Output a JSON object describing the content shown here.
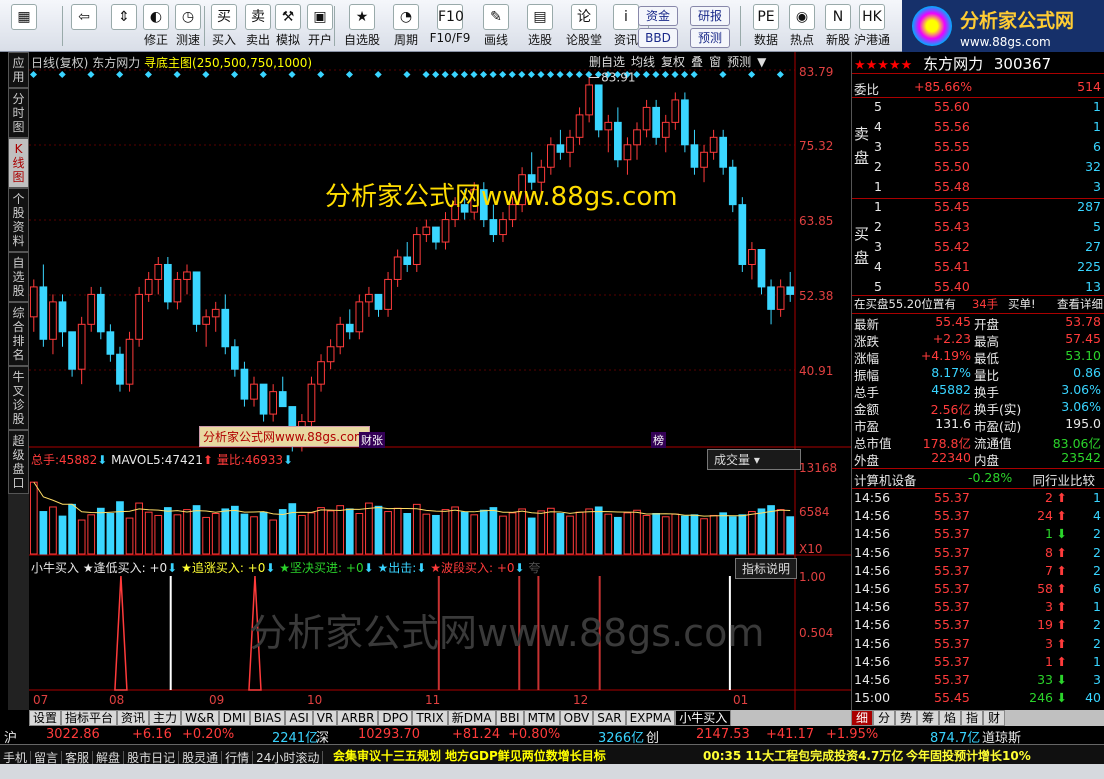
{
  "toolbar": {
    "buttons": [
      {
        "label": "",
        "icon": "windows-icon",
        "glyph": "▦"
      },
      {
        "label": "",
        "icon": "back-arrow-icon",
        "glyph": "⇦"
      },
      {
        "label": "",
        "icon": "updown-icon",
        "glyph": "⇕"
      },
      {
        "label": "修正",
        "icon": "repair-icon",
        "glyph": "◐"
      },
      {
        "label": "测速",
        "icon": "speed-icon",
        "glyph": "◷"
      },
      {
        "label": "买入",
        "icon": "buy-icon",
        "glyph": "买"
      },
      {
        "label": "卖出",
        "icon": "sell-icon",
        "glyph": "卖"
      },
      {
        "label": "模拟",
        "icon": "hammer-icon",
        "glyph": "⚒"
      },
      {
        "label": "开户",
        "icon": "lock-icon",
        "glyph": "▣"
      },
      {
        "label": "自选股",
        "icon": "star-folder-icon",
        "glyph": "★"
      },
      {
        "label": "周期",
        "icon": "clock-icon",
        "glyph": "◔"
      },
      {
        "label": "F10/F9",
        "icon": "f10-icon",
        "glyph": "F10"
      },
      {
        "label": "画线",
        "icon": "pen-icon",
        "glyph": "✎"
      },
      {
        "label": "选股",
        "icon": "screen-icon",
        "glyph": "▤"
      },
      {
        "label": "论股堂",
        "icon": "forum-icon",
        "glyph": "论"
      },
      {
        "label": "资讯",
        "icon": "info-icon",
        "glyph": "i"
      },
      {
        "label": "数据",
        "icon": "pe-icon",
        "glyph": "PE"
      },
      {
        "label": "热点",
        "icon": "hot-icon",
        "glyph": "◉"
      },
      {
        "label": "新股",
        "icon": "new-stock-icon",
        "glyph": "N"
      },
      {
        "label": "沪港通",
        "icon": "hk-connect-icon",
        "glyph": "HK"
      }
    ],
    "text_buttons": [
      "资金",
      "BBD",
      "研报",
      "预测"
    ]
  },
  "logo": {
    "name": "分析家公式网",
    "url": "www.88gs.com"
  },
  "left_tabs": [
    "应用",
    "分时图",
    "K线图",
    "个股资料",
    "自选股",
    "综合排名",
    "牛叉诊股",
    "超级盘口"
  ],
  "chart": {
    "title": "日线(复权)",
    "stock": "东方网力",
    "study": "寻底主图(250,500,750,1000)",
    "options": [
      "删自选",
      "均线",
      "复权",
      "叠",
      "窗",
      "预测"
    ],
    "max_label": "83.91",
    "watermark": "分析家公式网www.88gs.com",
    "stamp": "分析家公式网www.88gs.com",
    "badges": [
      "财张",
      "榜"
    ],
    "volume": {
      "total_label": "总手:",
      "total": "45882",
      "ma_label": "MAVOL5:",
      "ma": "47421",
      "ratio_label": "量比:",
      "ratio": "46933",
      "selector": "成交量"
    },
    "indicator": {
      "name": "小牛买入",
      "items": [
        "逢低买入: +0",
        "追涨买入: +0",
        "坚决买进: +0",
        "出击:",
        "波段买入: +0"
      ],
      "button": "指标说明",
      "faint": "夸"
    },
    "price_axis": [
      "83.79",
      "75.32",
      "63.85",
      "52.38",
      "40.91"
    ],
    "vol_axis": [
      "13168",
      "6584",
      "X10"
    ],
    "ind_axis": [
      "1.00",
      "0.504"
    ],
    "months": [
      "07",
      "08",
      "09",
      "10",
      "11",
      "12",
      "01"
    ],
    "bg_watermark": "分析家公式网www.88gs.com"
  },
  "chart_data": {
    "type": "candlestick",
    "title": "日线(复权)",
    "ylim": [
      35,
      85
    ],
    "candles": [
      [
        52,
        57,
        50,
        56
      ],
      [
        56,
        59,
        48,
        49
      ],
      [
        49,
        55,
        47,
        54
      ],
      [
        54,
        55,
        48,
        50
      ],
      [
        50,
        50,
        44,
        45
      ],
      [
        45,
        52,
        43,
        51
      ],
      [
        51,
        56,
        50,
        55
      ],
      [
        55,
        56,
        49,
        50
      ],
      [
        50,
        51,
        46,
        47
      ],
      [
        47,
        48,
        42,
        43
      ],
      [
        43,
        50,
        42,
        49
      ],
      [
        49,
        56,
        48,
        55
      ],
      [
        55,
        58,
        54,
        57
      ],
      [
        57,
        60,
        55,
        59
      ],
      [
        59,
        60,
        53,
        54
      ],
      [
        54,
        58,
        53,
        57
      ],
      [
        57,
        59,
        55,
        58
      ],
      [
        58,
        58,
        50,
        51
      ],
      [
        51,
        53,
        48,
        52
      ],
      [
        52,
        54,
        50,
        53
      ],
      [
        53,
        55,
        47,
        48
      ],
      [
        48,
        49,
        44,
        45
      ],
      [
        45,
        46,
        40,
        41
      ],
      [
        41,
        44,
        40,
        43
      ],
      [
        43,
        43,
        38,
        39
      ],
      [
        39,
        43,
        38,
        42
      ],
      [
        42,
        44,
        40,
        40
      ],
      [
        40,
        40,
        34,
        35
      ],
      [
        35,
        39,
        34,
        38
      ],
      [
        38,
        44,
        37,
        43
      ],
      [
        43,
        47,
        42,
        46
      ],
      [
        46,
        49,
        45,
        48
      ],
      [
        48,
        52,
        47,
        51
      ],
      [
        51,
        53,
        49,
        50
      ],
      [
        50,
        55,
        49,
        54
      ],
      [
        54,
        56,
        52,
        55
      ],
      [
        55,
        55,
        52,
        53
      ],
      [
        53,
        58,
        52,
        57
      ],
      [
        57,
        61,
        56,
        60
      ],
      [
        60,
        62,
        58,
        59
      ],
      [
        59,
        64,
        58,
        63
      ],
      [
        63,
        65,
        62,
        64
      ],
      [
        64,
        64,
        61,
        62
      ],
      [
        62,
        66,
        61,
        65
      ],
      [
        65,
        68,
        64,
        67
      ],
      [
        67,
        69,
        65,
        66
      ],
      [
        66,
        70,
        65,
        69
      ],
      [
        69,
        70,
        64,
        65
      ],
      [
        65,
        67,
        62,
        63
      ],
      [
        63,
        66,
        62,
        65
      ],
      [
        65,
        68,
        64,
        67
      ],
      [
        67,
        72,
        66,
        71
      ],
      [
        71,
        74,
        69,
        70
      ],
      [
        70,
        73,
        68,
        72
      ],
      [
        72,
        76,
        71,
        75
      ],
      [
        75,
        77,
        73,
        74
      ],
      [
        74,
        77,
        72,
        76
      ],
      [
        76,
        80,
        75,
        79
      ],
      [
        79,
        84,
        78,
        83
      ],
      [
        83,
        83,
        76,
        77
      ],
      [
        77,
        79,
        74,
        78
      ],
      [
        78,
        80,
        72,
        73
      ],
      [
        73,
        76,
        71,
        75
      ],
      [
        75,
        78,
        73,
        77
      ],
      [
        77,
        81,
        76,
        80
      ],
      [
        80,
        81,
        75,
        76
      ],
      [
        76,
        79,
        74,
        78
      ],
      [
        78,
        82,
        77,
        81
      ],
      [
        81,
        82,
        74,
        75
      ],
      [
        75,
        77,
        71,
        72
      ],
      [
        72,
        75,
        70,
        74
      ],
      [
        74,
        77,
        73,
        76
      ],
      [
        76,
        77,
        71,
        72
      ],
      [
        72,
        73,
        66,
        67
      ],
      [
        67,
        68,
        58,
        59
      ],
      [
        59,
        62,
        57,
        61
      ],
      [
        61,
        61,
        55,
        56
      ],
      [
        56,
        57,
        51,
        53
      ],
      [
        53,
        57,
        52,
        56
      ],
      [
        56,
        58,
        54,
        55
      ]
    ],
    "volume_max": 13168,
    "volume": [
      11000,
      6500,
      7200,
      5800,
      7600,
      5200,
      6000,
      7000,
      6200,
      8000,
      5500,
      7800,
      6400,
      5900,
      7100,
      6000,
      6800,
      7400,
      5600,
      6200,
      6900,
      7300,
      6100,
      5700,
      6400,
      5200,
      6800,
      7700,
      5900,
      6300,
      7100,
      6600,
      7400,
      6900,
      6200,
      7800,
      7300,
      6500,
      7000,
      6200,
      7600,
      6100,
      5900,
      6800,
      7200,
      6400,
      6000,
      6700,
      7100,
      5800,
      6300,
      6900,
      5500,
      6600,
      7000,
      6200,
      5800,
      6400,
      6900,
      7200,
      6100,
      5600,
      6300,
      6700,
      5900,
      6200,
      5700,
      6100,
      5800,
      6000,
      5400,
      5900,
      6300,
      5700,
      6000,
      6500,
      6900,
      7400,
      6800,
      5700
    ],
    "signals": [
      {
        "pos": 0.12,
        "kind": "spike"
      },
      {
        "pos": 0.185,
        "kind": "white"
      },
      {
        "pos": 0.295,
        "kind": "spike"
      },
      {
        "pos": 0.535,
        "kind": "line"
      },
      {
        "pos": 0.64,
        "kind": "line"
      },
      {
        "pos": 0.665,
        "kind": "line"
      },
      {
        "pos": 0.745,
        "kind": "line"
      },
      {
        "pos": 0.915,
        "kind": "white"
      }
    ]
  },
  "quote": {
    "stars": "★★★★★",
    "name": "东方网力",
    "code": "300367",
    "webi_label": "委比",
    "webi": "+85.66%",
    "webi_diff": "514",
    "sell_label": "卖盘",
    "buy_label": "买盘",
    "sells": [
      [
        "5",
        "55.60",
        "1"
      ],
      [
        "4",
        "55.56",
        "1"
      ],
      [
        "3",
        "55.55",
        "6"
      ],
      [
        "2",
        "55.50",
        "32"
      ],
      [
        "1",
        "55.48",
        "3"
      ]
    ],
    "buys": [
      [
        "1",
        "55.45",
        "287"
      ],
      [
        "2",
        "55.43",
        "5"
      ],
      [
        "3",
        "55.42",
        "27"
      ],
      [
        "4",
        "55.41",
        "225"
      ],
      [
        "5",
        "55.40",
        "13"
      ]
    ],
    "bid_note": "在买盘55.20位置有",
    "bid_note_qty": "34手",
    "bid_note_right": "买单!",
    "detail_link": "查看详细",
    "stats": [
      [
        "最新",
        "55.45",
        "开盘",
        "53.78"
      ],
      [
        "涨跌",
        "+2.23",
        "最高",
        "57.45"
      ],
      [
        "涨幅",
        "+4.19%",
        "最低",
        "53.10"
      ],
      [
        "振幅",
        "8.17%",
        "量比",
        "0.86"
      ],
      [
        "总手",
        "45882",
        "换手",
        "3.06%"
      ],
      [
        "金额",
        "2.56亿",
        "换手(实)",
        "3.06%"
      ],
      [
        "市盈",
        "131.6",
        "市盈(动)",
        "195.0"
      ],
      [
        "总市值",
        "178.8亿",
        "流通值",
        "83.06亿"
      ],
      [
        "外盘",
        "22340",
        "内盘",
        "23542"
      ]
    ],
    "sector": "计算机设备",
    "sector_chg": "-0.28%",
    "peer_link": "同行业比较",
    "ticks": [
      [
        "14:56",
        "55.37",
        "2",
        "up",
        "1"
      ],
      [
        "14:56",
        "55.37",
        "24",
        "up",
        "4"
      ],
      [
        "14:56",
        "55.37",
        "1",
        "down",
        "2"
      ],
      [
        "14:56",
        "55.37",
        "8",
        "up",
        "2"
      ],
      [
        "14:56",
        "55.37",
        "7",
        "up",
        "2"
      ],
      [
        "14:56",
        "55.37",
        "58",
        "up",
        "6"
      ],
      [
        "14:56",
        "55.37",
        "3",
        "up",
        "1"
      ],
      [
        "14:56",
        "55.37",
        "19",
        "up",
        "2"
      ],
      [
        "14:56",
        "55.37",
        "3",
        "up",
        "2"
      ],
      [
        "14:56",
        "55.37",
        "1",
        "up",
        "1"
      ],
      [
        "14:56",
        "55.37",
        "33",
        "down",
        "3"
      ],
      [
        "15:00",
        "55.45",
        "246",
        "down",
        "40"
      ]
    ]
  },
  "bottom_tabs": [
    "设置",
    "指标平台",
    "资讯",
    "主力",
    "W&R",
    "DMI",
    "BIAS",
    "ASI",
    "VR",
    "ARBR",
    "DPO",
    "TRIX",
    "新DMA",
    "BBI",
    "MTM",
    "OBV",
    "SAR",
    "EXPMA",
    "小牛买入"
  ],
  "right_tabs": [
    "细",
    "分",
    "势",
    "筹",
    "焰",
    "指",
    "财"
  ],
  "index_bar": {
    "sh_label": "沪",
    "sh": "3022.86",
    "sh_chg": "+6.16",
    "sh_pct": "+0.20%",
    "sh_amt": "2241亿",
    "sz_label": "深",
    "sz": "10293.70",
    "sz_chg": "+81.24",
    "sz_pct": "+0.80%",
    "sz_amt": "3266亿",
    "cy_label": "创",
    "cy": "2147.53",
    "cy_chg": "+41.17",
    "cy_pct": "+1.95%",
    "cy_amt": "874.7亿",
    "dj_label": "道琼斯"
  },
  "status_bar": {
    "buttons": [
      "手机",
      "留言",
      "客服",
      "解盘",
      "股市日记",
      "股灵通",
      "行情",
      "24小时滚动"
    ],
    "news": "会集审议十三五规划 地方GDP鲜见两位数增长目标",
    "news2": "00:35 11大工程包完成投资4.7万亿",
    "news3": "今年固投预计增长10%"
  }
}
